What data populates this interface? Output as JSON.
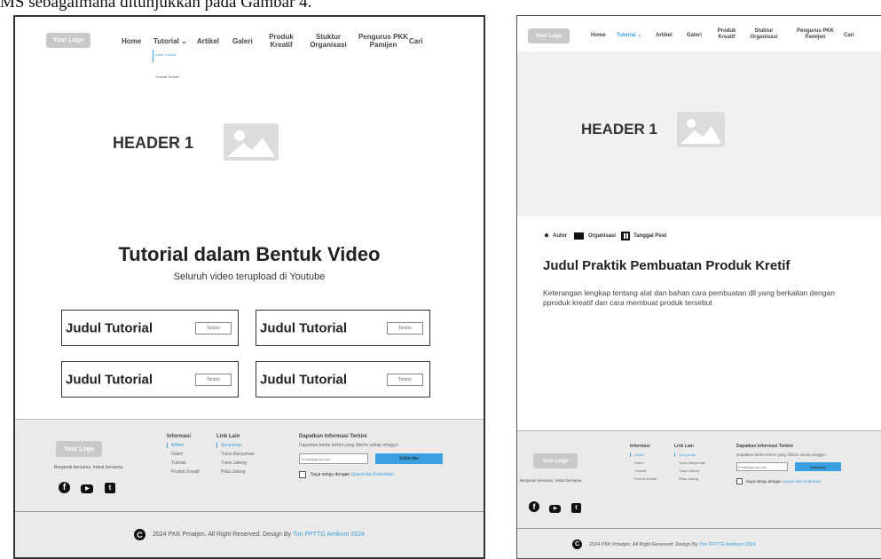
{
  "caption": "MS sebagaimana ditunjukkan pada Gambar 4.",
  "nav": {
    "logo": "Your Logo",
    "items": [
      "Home",
      "Tutorial ⌄",
      "Artikel",
      "Galeri",
      "Produk Kreatif",
      "Stuktur Organisasi",
      "Pengurus PKK Pamijen",
      "Cari"
    ],
    "dropdown": [
      "Video Tutorial",
      "Tutorial Tertulis"
    ]
  },
  "hero": {
    "title": "HEADER 1"
  },
  "left": {
    "section_title": "Tutorial dalam Bentuk Video",
    "section_subtitle": "Seluruh video terupload di Youtube",
    "cards": [
      {
        "title": "Judul Tutorial",
        "button": "Tonton"
      },
      {
        "title": "Judul Tutorial",
        "button": "Tonton"
      },
      {
        "title": "Judul Tutorial",
        "button": "Tonton"
      },
      {
        "title": "Judul Tutorial",
        "button": "Tonton"
      }
    ]
  },
  "right": {
    "meta": [
      "Autor",
      "Organisasi",
      "Tanggal Post"
    ],
    "title": "Judul Praktik Pembuatan Produk Kretif",
    "body": "Keterangan lengkap tentang alat dan bahan cara pembuatan dll yang berkaitan dengan pproduk kreatif dan cara membuat produk tersebut"
  },
  "footer": {
    "logo": "Your Logo",
    "tagline": "Bergerak bersama, hebat bersama",
    "social_icons": [
      "facebook-icon",
      "youtube-icon",
      "twitter-icon"
    ],
    "col1_title": "Informasi",
    "col1": [
      "Artikel",
      "Galeri",
      "Tutorial",
      "Produk Kreatif"
    ],
    "col2_title": "Link Lain",
    "col2": [
      "Senyumas",
      "Trans Banyumas",
      "Trans Jateng",
      "Pilda Jateng"
    ],
    "newsletter_title": "Dapatkan Informasi Terkini",
    "newsletter_text": "Dapatkan berita terkini yang dikirim setiap minggu!",
    "email_placeholder": "Email@gmail.com",
    "subscribe": "Subscribe",
    "agree_prefix": "Saya setuju dengan",
    "agree_link": "Syarat dan Ketentuan",
    "copyright_prefix": "2024 PKK Pmaijen. All Right Reserved. Design By",
    "copyright_link": "Tim PPTTG Amikom 2024"
  },
  "colors": {
    "accent": "#3aa0e0",
    "logo_bg": "#c9c9c9",
    "hero_bg": "#f1f1f1",
    "footer_bg": "#eaeaea"
  }
}
